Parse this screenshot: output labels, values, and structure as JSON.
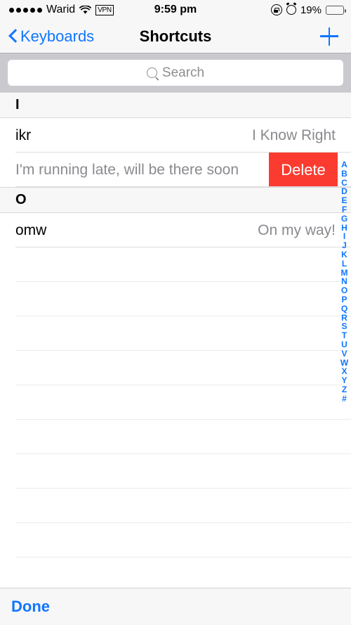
{
  "status_bar": {
    "signal_dots": 5,
    "carrier": "Warid",
    "wifi_icon": "wifi-icon",
    "vpn_label": "VPN",
    "time": "9:59 pm",
    "rotation_lock_icon": "rotation-lock-icon",
    "alarm_icon": "alarm-clock-icon",
    "battery_percent": "19%",
    "battery_level": 19,
    "battery_color": "#f4312b"
  },
  "navbar": {
    "back_label": "Keyboards",
    "back_icon": "chevron-left-icon",
    "title": "Shortcuts",
    "add_icon": "plus-icon",
    "tint_color": "#1076ff"
  },
  "search": {
    "placeholder": "Search",
    "icon": "search-icon",
    "value": ""
  },
  "sections": [
    {
      "header": "I",
      "rows": [
        {
          "shortcut": "ikr",
          "phrase": "I Know Right",
          "swiped": false
        },
        {
          "shortcut": "",
          "phrase": "I'm running late, will be there soon",
          "swiped": true,
          "delete_label": "Delete",
          "delete_color": "#fb3b30"
        }
      ]
    },
    {
      "header": "O",
      "rows": [
        {
          "shortcut": "omw",
          "phrase": "On my way!",
          "swiped": false
        }
      ]
    }
  ],
  "empty_row_count": 9,
  "index_bar": {
    "letters": [
      "A",
      "B",
      "C",
      "D",
      "E",
      "F",
      "G",
      "H",
      "I",
      "J",
      "K",
      "L",
      "M",
      "N",
      "O",
      "P",
      "Q",
      "R",
      "S",
      "T",
      "U",
      "V",
      "W",
      "X",
      "Y",
      "Z",
      "#"
    ],
    "color": "#1076ff"
  },
  "toolbar": {
    "done_label": "Done"
  }
}
